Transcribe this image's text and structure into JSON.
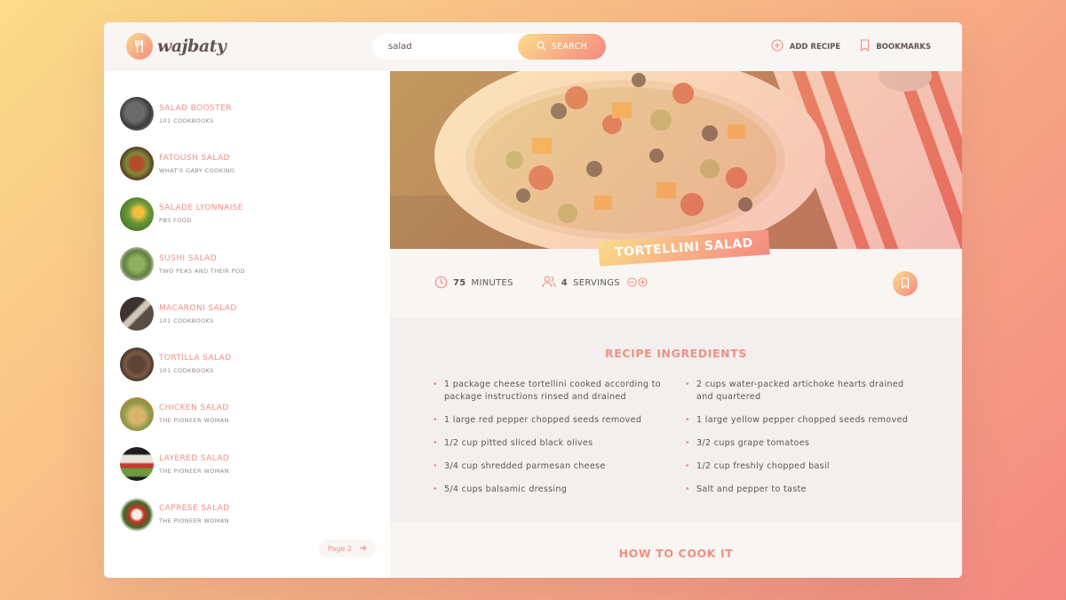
{
  "app": {
    "logo_text": "wajbaty"
  },
  "search": {
    "value": "salad",
    "button_label": "SEARCH"
  },
  "nav": {
    "add_recipe": "ADD RECIPE",
    "bookmarks": "BOOKMARKS"
  },
  "results": [
    {
      "title": "SALAD BOOSTER",
      "publisher": "101 COOKBOOKS"
    },
    {
      "title": "FATOUSH SALAD",
      "publisher": "WHAT'S GABY COOKING"
    },
    {
      "title": "SALADE LYONNAISE",
      "publisher": "PBS FOOD"
    },
    {
      "title": "SUSHI SALAD",
      "publisher": "TWO PEAS AND THEIR POD"
    },
    {
      "title": "MACARONI SALAD",
      "publisher": "101 COOKBOOKS"
    },
    {
      "title": "TORTILLA SALAD",
      "publisher": "101 COOKBOOKS"
    },
    {
      "title": "CHICKEN SALAD",
      "publisher": "THE PIONEER WOMAN"
    },
    {
      "title": "LAYERED SALAD",
      "publisher": "THE PIONEER WOMAN"
    },
    {
      "title": "CAPRESE SALAD",
      "publisher": "THE PIONEER WOMAN"
    }
  ],
  "pagination": {
    "next_label": "Page 2"
  },
  "recipe": {
    "title": "TORTELLINI SALAD",
    "minutes_value": "75",
    "minutes_label": "MINUTES",
    "servings_value": "4",
    "servings_label": "SERVINGS",
    "ingredients_heading": "RECIPE INGREDIENTS",
    "ingredients": [
      "1 package cheese tortellini cooked according to package instructions rinsed and drained",
      "2 cups water-packed artichoke hearts drained and quartered",
      "1 large red pepper chopped seeds removed",
      "1 large yellow pepper chopped seeds removed",
      "1/2 cup pitted sliced black olives",
      "3/2 cups grape tomatoes",
      "3/4 cup shredded parmesan cheese",
      "1/2 cup freshly chopped basil",
      "5/4 cups balsamic dressing",
      "Salt and pepper to taste"
    ],
    "howto_heading": "HOW TO COOK IT"
  },
  "colors": {
    "accent_start": "#fbdb89",
    "accent_end": "#f48982",
    "text": "#615551",
    "accent_text": "#f38e82"
  },
  "icons": [
    "fork-knife-logo-icon",
    "search-icon",
    "plus-circle-icon",
    "bookmark-icon",
    "clock-icon",
    "users-icon",
    "minus-circle-icon",
    "plus-circle-icon",
    "arrow-right-icon"
  ]
}
